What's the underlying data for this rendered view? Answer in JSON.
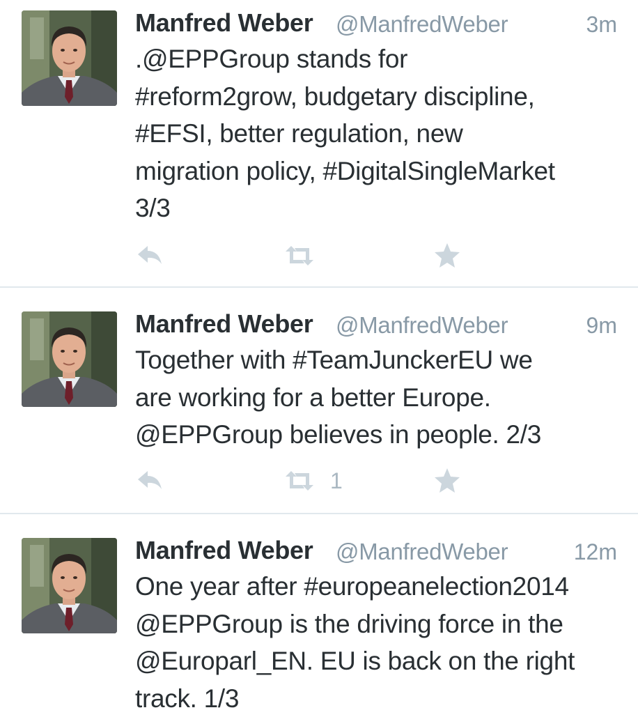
{
  "tweets": [
    {
      "name": "Manfred Weber",
      "handle": "@ManfredWeber",
      "time": "3m",
      "lines": [
        ".@EPPGroup stands for",
        "#reform2grow, budgetary discipline,",
        "#EFSI, better regulation, new",
        "migration policy, #DigitalSingleMarket",
        "3/3"
      ],
      "retweet_count": ""
    },
    {
      "name": "Manfred Weber",
      "handle": "@ManfredWeber",
      "time": "9m",
      "lines": [
        "Together with #TeamJunckerEU we",
        "are working for a better Europe.",
        "@EPPGroup believes in people. 2/3"
      ],
      "retweet_count": "1"
    },
    {
      "name": "Manfred Weber",
      "handle": "@ManfredWeber",
      "time": "12m",
      "lines": [
        "One year after #europeanelection2014",
        "@EPPGroup is the driving force in the",
        "@Europarl_EN. EU is back on the right",
        "track. 1/3"
      ],
      "retweet_count": ""
    }
  ],
  "icons": {
    "reply": "reply-icon",
    "retweet": "retweet-icon",
    "favorite": "star-icon"
  },
  "colors": {
    "text": "#292f33",
    "secondary": "#8899a6",
    "action_icon": "#ccd6dd",
    "divider": "#e1e8ed"
  }
}
